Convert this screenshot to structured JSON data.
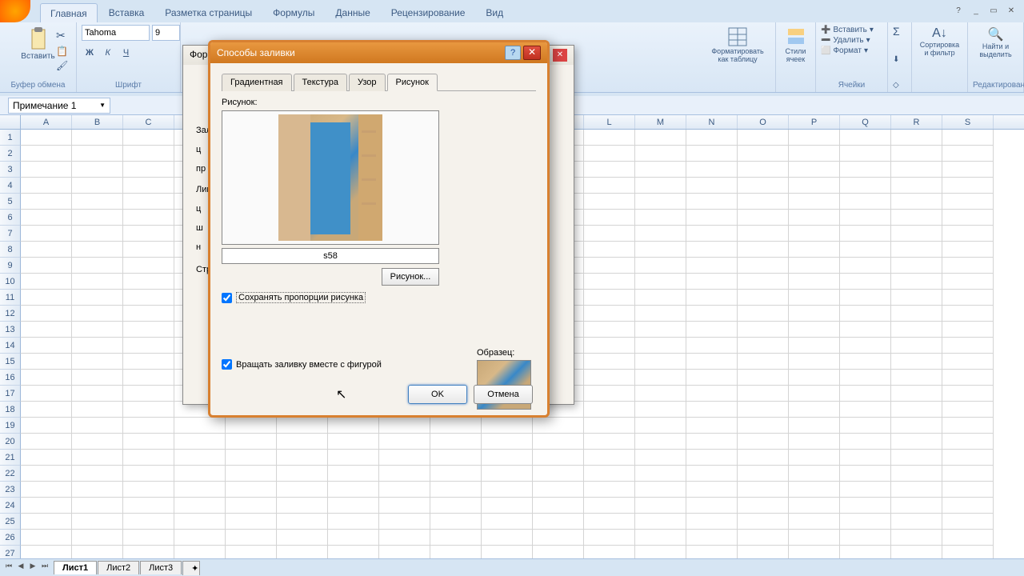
{
  "ribbon": {
    "tabs": [
      "Главная",
      "Вставка",
      "Разметка страницы",
      "Формулы",
      "Данные",
      "Рецензирование",
      "Вид"
    ],
    "active_tab": 0,
    "clipboard_label": "Буфер обмена",
    "paste_label": "Вставить",
    "font_label": "Шрифт",
    "font_name": "Tahoma",
    "font_size": "9",
    "cells": {
      "insert": "Вставить",
      "delete": "Удалить",
      "format": "Формат",
      "group": "Ячейки"
    },
    "styles": {
      "format_table": "Форматировать как таблицу",
      "cell_styles": "Стили ячеек"
    },
    "editing": {
      "sort_filter": "Сортировка и фильтр",
      "find_select": "Найти и выделить",
      "group": "Редактирование"
    }
  },
  "name_box": "Примечание 1",
  "columns": [
    "A",
    "B",
    "C",
    "",
    "",
    "",
    "",
    "",
    "",
    "",
    "",
    "L",
    "M",
    "N",
    "O",
    "P",
    "Q",
    "R",
    "S"
  ],
  "row_count": 27,
  "sheets": {
    "tabs": [
      "Лист1",
      "Лист2",
      "Лист3"
    ],
    "active": 0
  },
  "format_dialog": {
    "title": "Форм",
    "side_labels": [
      "Зал",
      "ц",
      "пр",
      "Лин",
      "ц",
      "ш",
      "н",
      "Стр"
    ]
  },
  "fill_dialog": {
    "title": "Способы заливки",
    "tabs": [
      "Градиентная",
      "Текстура",
      "Узор",
      "Рисунок"
    ],
    "active_tab": 3,
    "picture_label": "Рисунок:",
    "picture_name": "s58",
    "browse": "Рисунок...",
    "preserve_ratio": "Сохранять пропорции рисунка",
    "preserve_ratio_checked": true,
    "rotate_with_shape": "Вращать заливку вместе с фигурой",
    "rotate_checked": true,
    "sample_label": "Образец:",
    "ok": "OK",
    "cancel": "Отмена"
  }
}
